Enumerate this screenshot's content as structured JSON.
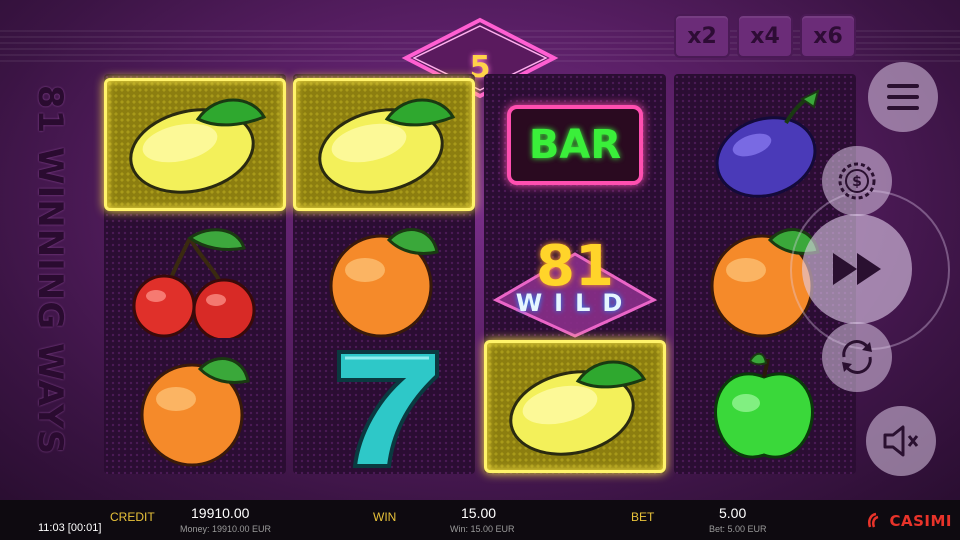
{
  "game": {
    "side_title": "81 WINNING WAYS",
    "ways_counter": "5",
    "multipliers": [
      "x2",
      "x4",
      "x6"
    ]
  },
  "reels": [
    [
      {
        "symbol": "lemon",
        "highlighted": true
      },
      {
        "symbol": "cherry",
        "highlighted": false
      },
      {
        "symbol": "orange",
        "highlighted": false
      }
    ],
    [
      {
        "symbol": "lemon",
        "highlighted": true
      },
      {
        "symbol": "orange",
        "highlighted": false
      },
      {
        "symbol": "seven",
        "highlighted": false
      }
    ],
    [
      {
        "symbol": "bar",
        "label": "BAR",
        "highlighted": false
      },
      {
        "symbol": "wild",
        "label_top": "81",
        "label_bottom": "WILD",
        "highlighted": false
      },
      {
        "symbol": "lemon",
        "highlighted": true
      }
    ],
    [
      {
        "symbol": "plum",
        "highlighted": false
      },
      {
        "symbol": "orange",
        "highlighted": false
      },
      {
        "symbol": "apple",
        "highlighted": false
      }
    ]
  ],
  "controls": [
    "menu-icon",
    "coin-icon",
    "fast-forward-icon",
    "autoplay-icon",
    "sound-off-icon"
  ],
  "status_bar": {
    "credit_label": "CREDIT",
    "credit_value": "19910.00",
    "credit_sub": "Money: 19910.00 EUR",
    "win_label": "WIN",
    "win_value": "15.00",
    "win_sub": "Win: 15.00 EUR",
    "bet_label": "BET",
    "bet_value": "5.00",
    "bet_sub": "Bet: 5.00 EUR",
    "clock": "11:03 [00:01]",
    "brand": "casimi"
  },
  "colors": {
    "win_frame": "#fff36a",
    "label_gold": "#e8c23a",
    "brand_red": "#e8332a"
  }
}
